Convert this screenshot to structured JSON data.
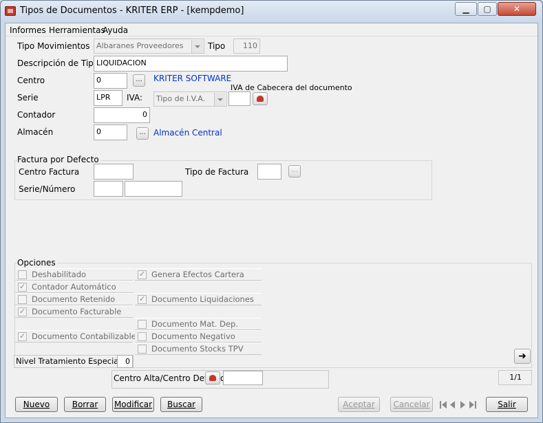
{
  "window": {
    "title": "Tipos de Documentos - KRITER ERP - [kempdemo]",
    "minimize": "▁",
    "maximize": "▢",
    "close": "✕"
  },
  "menu": [
    "Informes",
    "Herramientas",
    "Ayuda"
  ],
  "form": {
    "tipo_movimientos_label": "Tipo Movimientos",
    "tipo_movimientos_value": "Albaranes Proveedores",
    "tipo_label": "Tipo",
    "tipo_value": "110",
    "descripcion_label": "Descripción de Tipo",
    "descripcion_value": "LIQUIDACION",
    "centro_label": "Centro",
    "centro_value": "0",
    "centro_name": "KRITER SOFTWARE",
    "serie_label": "Serie",
    "serie_value": "LPR",
    "iva_label": "IVA:",
    "iva_value": "Tipo de I.V.A.",
    "iva_cabecera_label": "IVA de Cabecera del documento",
    "contador_label": "Contador",
    "contador_value": "0",
    "almacen_label": "Almacén",
    "almacen_value": "0",
    "almacen_name": "Almacén Central",
    "ellipsis": "..."
  },
  "factura": {
    "group_label": "Factura por Defecto",
    "centro_factura_label": "Centro Factura",
    "tipo_factura_label": "Tipo de Factura",
    "serie_numero_label": "Serie/Número"
  },
  "opciones": {
    "group_label": "Opciones",
    "left": [
      {
        "label": "Deshabilitado",
        "checked": false
      },
      {
        "label": "Contador Automático",
        "checked": true
      },
      {
        "label": "Documento Retenido",
        "checked": false
      },
      {
        "label": "Documento Facturable",
        "checked": true
      },
      {
        "label": "",
        "checked": false
      },
      {
        "label": "Documento Contabilizable",
        "checked": true
      }
    ],
    "right": [
      {
        "label": "Genera Efectos Cartera",
        "checked": true
      },
      {
        "label": "",
        "checked": false
      },
      {
        "label": "Documento Liquidaciones",
        "checked": true
      },
      {
        "label": "",
        "checked": false
      },
      {
        "label": "Documento Mat. Dep.",
        "checked": false
      },
      {
        "label": "Documento Negativo",
        "checked": false
      },
      {
        "label": "Documento Stocks TPV",
        "checked": false
      }
    ],
    "nivel_label": "Nivel Tratamiento Especial",
    "nivel_value": "0"
  },
  "centro_alta_label": "Centro Alta/Centro Defecto",
  "pager": "1/1",
  "buttons": {
    "nuevo": "Nuevo",
    "borrar": "Borrar",
    "modificar": "Modificar",
    "buscar": "Buscar",
    "aceptar": "Aceptar",
    "cancelar": "Cancelar",
    "salir": "Salir"
  }
}
